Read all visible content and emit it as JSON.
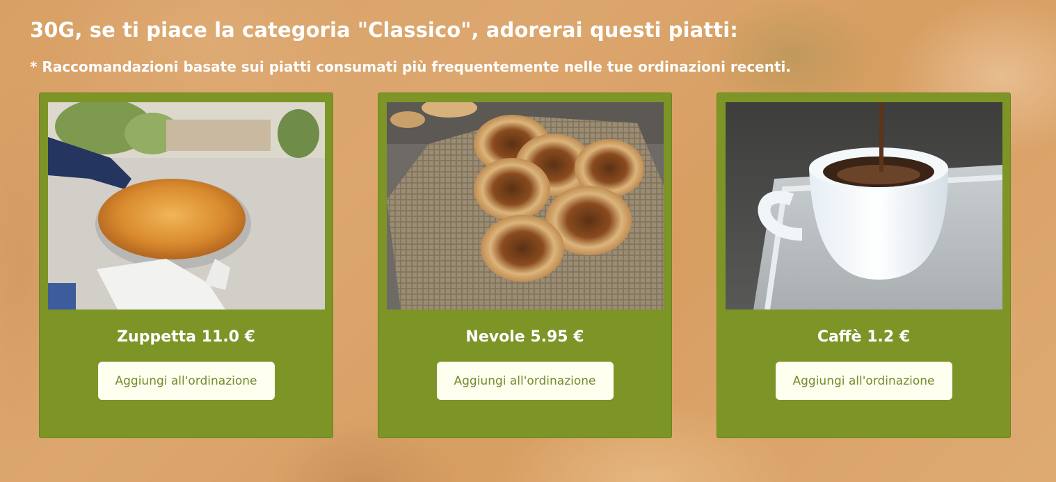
{
  "header": {
    "title": "30G, se ti piace la categoria \"Classico\", adorerai questi piatti:",
    "subtitle": "* Raccomandazioni basate sui piatti consumati più frequentemente nelle tue ordinazioni recenti."
  },
  "theme": {
    "card_color": "#7d9427",
    "button_bg": "#fffff0",
    "button_text": "#748a2a",
    "background": "#d9a56d"
  },
  "dishes": [
    {
      "name": "Zuppetta",
      "price": "11.0 €",
      "image": "zuppetta-photo",
      "button_label": "Aggiungi all'ordinazione"
    },
    {
      "name": "Nevole",
      "price": "5.95 €",
      "image": "nevole-photo",
      "button_label": "Aggiungi all'ordinazione"
    },
    {
      "name": "Caffè",
      "price": "1.2 €",
      "image": "caffe-photo",
      "button_label": "Aggiungi all'ordinazione"
    }
  ]
}
